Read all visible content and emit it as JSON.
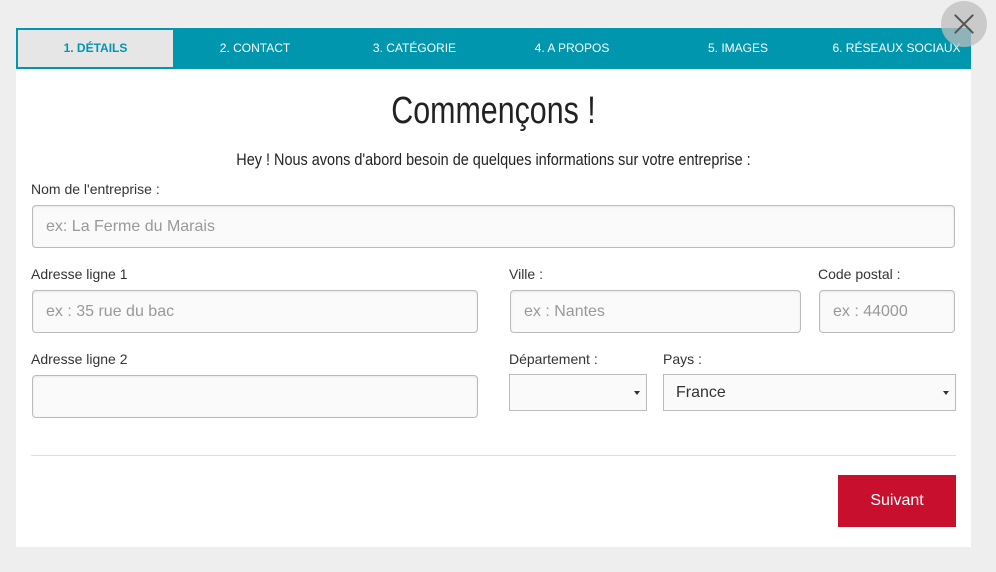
{
  "tabs": [
    "1. DÉTAILS",
    "2. CONTACT",
    "3. CATÉGORIE",
    "4. A PROPOS",
    "5. IMAGES",
    "6. RÉSEAUX SOCIAUX"
  ],
  "title": "Commençons !",
  "subtitle": "Hey ! Nous avons d'abord besoin de quelques informations sur votre entreprise :",
  "fields": {
    "company": {
      "label": "Nom de l'entreprise :",
      "placeholder": "ex: La Ferme du Marais"
    },
    "address1": {
      "label": "Adresse ligne 1",
      "placeholder": "ex : 35 rue du bac"
    },
    "city": {
      "label": "Ville :",
      "placeholder": "ex : Nantes"
    },
    "zip": {
      "label": "Code postal :",
      "placeholder": "ex : 44000"
    },
    "address2": {
      "label": "Adresse ligne 2",
      "placeholder": ""
    },
    "department": {
      "label": "Département :",
      "value": ""
    },
    "country": {
      "label": "Pays :",
      "value": "France"
    }
  },
  "next_label": "Suivant",
  "colors": {
    "accent": "#0097ae",
    "button": "#c8102e"
  }
}
